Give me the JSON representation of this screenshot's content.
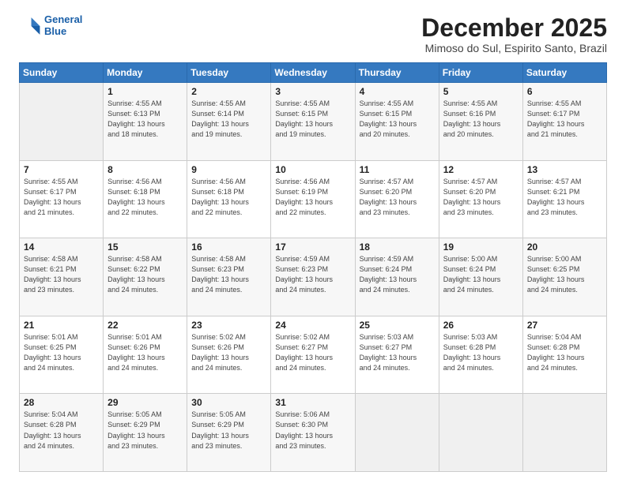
{
  "logo": {
    "line1": "General",
    "line2": "Blue"
  },
  "title": "December 2025",
  "subtitle": "Mimoso do Sul, Espirito Santo, Brazil",
  "days_header": [
    "Sunday",
    "Monday",
    "Tuesday",
    "Wednesday",
    "Thursday",
    "Friday",
    "Saturday"
  ],
  "weeks": [
    [
      {
        "day": "",
        "info": ""
      },
      {
        "day": "1",
        "info": "Sunrise: 4:55 AM\nSunset: 6:13 PM\nDaylight: 13 hours\nand 18 minutes."
      },
      {
        "day": "2",
        "info": "Sunrise: 4:55 AM\nSunset: 6:14 PM\nDaylight: 13 hours\nand 19 minutes."
      },
      {
        "day": "3",
        "info": "Sunrise: 4:55 AM\nSunset: 6:15 PM\nDaylight: 13 hours\nand 19 minutes."
      },
      {
        "day": "4",
        "info": "Sunrise: 4:55 AM\nSunset: 6:15 PM\nDaylight: 13 hours\nand 20 minutes."
      },
      {
        "day": "5",
        "info": "Sunrise: 4:55 AM\nSunset: 6:16 PM\nDaylight: 13 hours\nand 20 minutes."
      },
      {
        "day": "6",
        "info": "Sunrise: 4:55 AM\nSunset: 6:17 PM\nDaylight: 13 hours\nand 21 minutes."
      }
    ],
    [
      {
        "day": "7",
        "info": "Sunrise: 4:55 AM\nSunset: 6:17 PM\nDaylight: 13 hours\nand 21 minutes."
      },
      {
        "day": "8",
        "info": "Sunrise: 4:56 AM\nSunset: 6:18 PM\nDaylight: 13 hours\nand 22 minutes."
      },
      {
        "day": "9",
        "info": "Sunrise: 4:56 AM\nSunset: 6:18 PM\nDaylight: 13 hours\nand 22 minutes."
      },
      {
        "day": "10",
        "info": "Sunrise: 4:56 AM\nSunset: 6:19 PM\nDaylight: 13 hours\nand 22 minutes."
      },
      {
        "day": "11",
        "info": "Sunrise: 4:57 AM\nSunset: 6:20 PM\nDaylight: 13 hours\nand 23 minutes."
      },
      {
        "day": "12",
        "info": "Sunrise: 4:57 AM\nSunset: 6:20 PM\nDaylight: 13 hours\nand 23 minutes."
      },
      {
        "day": "13",
        "info": "Sunrise: 4:57 AM\nSunset: 6:21 PM\nDaylight: 13 hours\nand 23 minutes."
      }
    ],
    [
      {
        "day": "14",
        "info": "Sunrise: 4:58 AM\nSunset: 6:21 PM\nDaylight: 13 hours\nand 23 minutes."
      },
      {
        "day": "15",
        "info": "Sunrise: 4:58 AM\nSunset: 6:22 PM\nDaylight: 13 hours\nand 24 minutes."
      },
      {
        "day": "16",
        "info": "Sunrise: 4:58 AM\nSunset: 6:23 PM\nDaylight: 13 hours\nand 24 minutes."
      },
      {
        "day": "17",
        "info": "Sunrise: 4:59 AM\nSunset: 6:23 PM\nDaylight: 13 hours\nand 24 minutes."
      },
      {
        "day": "18",
        "info": "Sunrise: 4:59 AM\nSunset: 6:24 PM\nDaylight: 13 hours\nand 24 minutes."
      },
      {
        "day": "19",
        "info": "Sunrise: 5:00 AM\nSunset: 6:24 PM\nDaylight: 13 hours\nand 24 minutes."
      },
      {
        "day": "20",
        "info": "Sunrise: 5:00 AM\nSunset: 6:25 PM\nDaylight: 13 hours\nand 24 minutes."
      }
    ],
    [
      {
        "day": "21",
        "info": "Sunrise: 5:01 AM\nSunset: 6:25 PM\nDaylight: 13 hours\nand 24 minutes."
      },
      {
        "day": "22",
        "info": "Sunrise: 5:01 AM\nSunset: 6:26 PM\nDaylight: 13 hours\nand 24 minutes."
      },
      {
        "day": "23",
        "info": "Sunrise: 5:02 AM\nSunset: 6:26 PM\nDaylight: 13 hours\nand 24 minutes."
      },
      {
        "day": "24",
        "info": "Sunrise: 5:02 AM\nSunset: 6:27 PM\nDaylight: 13 hours\nand 24 minutes."
      },
      {
        "day": "25",
        "info": "Sunrise: 5:03 AM\nSunset: 6:27 PM\nDaylight: 13 hours\nand 24 minutes."
      },
      {
        "day": "26",
        "info": "Sunrise: 5:03 AM\nSunset: 6:28 PM\nDaylight: 13 hours\nand 24 minutes."
      },
      {
        "day": "27",
        "info": "Sunrise: 5:04 AM\nSunset: 6:28 PM\nDaylight: 13 hours\nand 24 minutes."
      }
    ],
    [
      {
        "day": "28",
        "info": "Sunrise: 5:04 AM\nSunset: 6:28 PM\nDaylight: 13 hours\nand 24 minutes."
      },
      {
        "day": "29",
        "info": "Sunrise: 5:05 AM\nSunset: 6:29 PM\nDaylight: 13 hours\nand 23 minutes."
      },
      {
        "day": "30",
        "info": "Sunrise: 5:05 AM\nSunset: 6:29 PM\nDaylight: 13 hours\nand 23 minutes."
      },
      {
        "day": "31",
        "info": "Sunrise: 5:06 AM\nSunset: 6:30 PM\nDaylight: 13 hours\nand 23 minutes."
      },
      {
        "day": "",
        "info": ""
      },
      {
        "day": "",
        "info": ""
      },
      {
        "day": "",
        "info": ""
      }
    ]
  ]
}
